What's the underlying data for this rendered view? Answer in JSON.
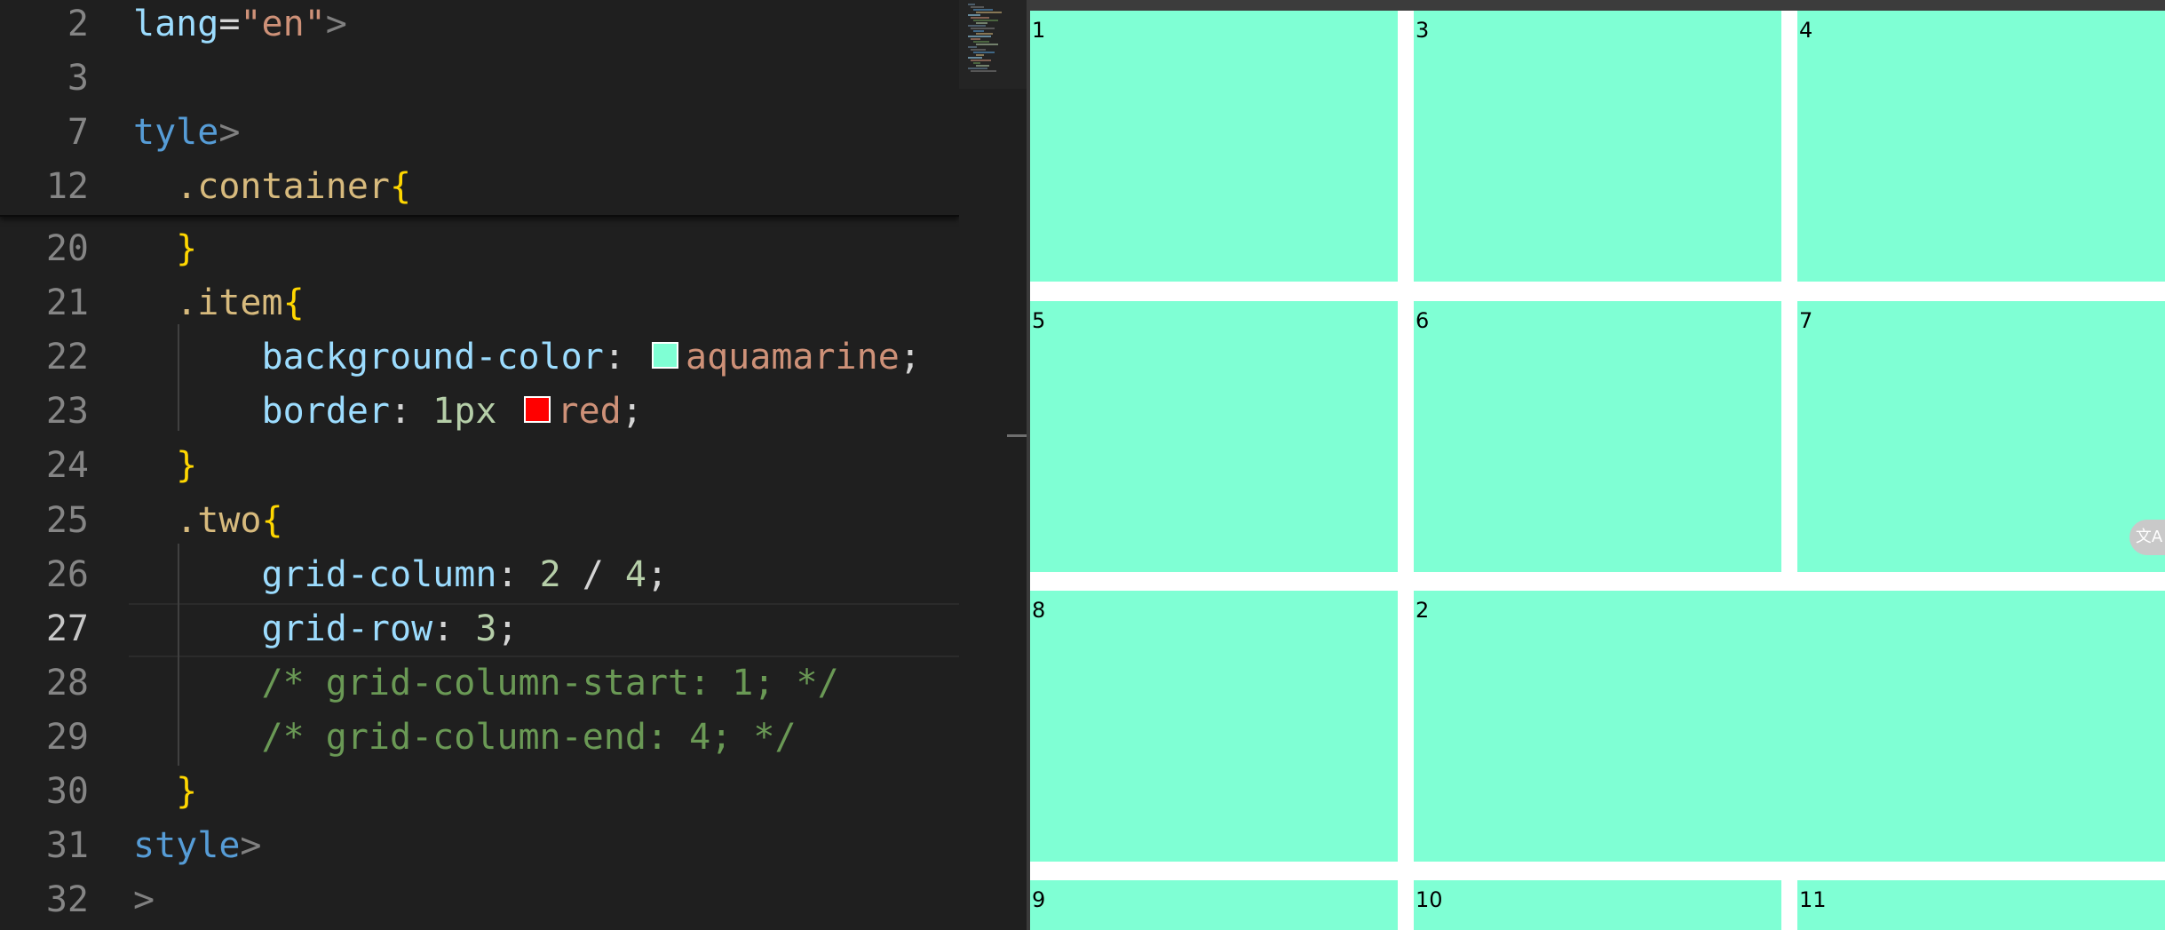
{
  "editor": {
    "sticky_lines": [
      {
        "num": "2",
        "tokens": [
          {
            "t": "lang",
            "c": "t-attr"
          },
          {
            "t": "=",
            "c": "t-def"
          },
          {
            "t": "\"en\"",
            "c": "t-str"
          },
          {
            "t": ">",
            "c": "t-punc"
          }
        ]
      },
      {
        "num": "3",
        "tokens": [
          {
            "t": "",
            "c": "t-def"
          }
        ]
      },
      {
        "num": "7",
        "tokens": [
          {
            "t": "tyle",
            "c": "t-tag"
          },
          {
            "t": ">",
            "c": "t-punc"
          }
        ]
      },
      {
        "num": "12",
        "tokens": [
          {
            "t": "  .container",
            "c": "t-sel"
          },
          {
            "t": "{",
            "c": "t-brace"
          }
        ]
      }
    ],
    "lines": [
      {
        "num": "20",
        "tokens": [
          {
            "t": "  ",
            "c": "t-def"
          },
          {
            "t": "}",
            "c": "t-brace"
          }
        ]
      },
      {
        "num": "21",
        "tokens": [
          {
            "t": "  .item",
            "c": "t-sel"
          },
          {
            "t": "{",
            "c": "t-brace"
          }
        ]
      },
      {
        "num": "22",
        "tokens": [
          {
            "t": "      background-color",
            "c": "t-prop"
          },
          {
            "t": ": ",
            "c": "t-def"
          },
          {
            "swatch": "#7fffd4"
          },
          {
            "t": "aquamarine",
            "c": "t-val"
          },
          {
            "t": ";",
            "c": "t-def"
          }
        ]
      },
      {
        "num": "23",
        "tokens": [
          {
            "t": "      border",
            "c": "t-prop"
          },
          {
            "t": ": ",
            "c": "t-def"
          },
          {
            "t": "1px",
            "c": "t-num"
          },
          {
            "t": " ",
            "c": "t-def"
          },
          {
            "swatch": "#ff0000"
          },
          {
            "t": "red",
            "c": "t-val"
          },
          {
            "t": ";",
            "c": "t-def"
          }
        ]
      },
      {
        "num": "24",
        "tokens": [
          {
            "t": "  ",
            "c": "t-def"
          },
          {
            "t": "}",
            "c": "t-brace"
          }
        ]
      },
      {
        "num": "25",
        "tokens": [
          {
            "t": "  .two",
            "c": "t-sel"
          },
          {
            "t": "{",
            "c": "t-brace"
          }
        ]
      },
      {
        "num": "26",
        "tokens": [
          {
            "t": "      grid-column",
            "c": "t-prop"
          },
          {
            "t": ": ",
            "c": "t-def"
          },
          {
            "t": "2",
            "c": "t-num"
          },
          {
            "t": " / ",
            "c": "t-def"
          },
          {
            "t": "4",
            "c": "t-num"
          },
          {
            "t": ";",
            "c": "t-def"
          }
        ]
      },
      {
        "num": "27",
        "active": true,
        "tokens": [
          {
            "t": "      grid-row",
            "c": "t-prop"
          },
          {
            "t": ": ",
            "c": "t-def"
          },
          {
            "t": "3",
            "c": "t-num"
          },
          {
            "t": ";",
            "c": "t-def"
          }
        ]
      },
      {
        "num": "28",
        "tokens": [
          {
            "t": "      /* grid-column-start: 1; */",
            "c": "t-com"
          }
        ]
      },
      {
        "num": "29",
        "tokens": [
          {
            "t": "      /* grid-column-end: 4; */",
            "c": "t-com"
          }
        ]
      },
      {
        "num": "30",
        "tokens": [
          {
            "t": "  ",
            "c": "t-def"
          },
          {
            "t": "}",
            "c": "t-brace"
          }
        ]
      },
      {
        "num": "31",
        "tokens": [
          {
            "t": "style",
            "c": "t-tag"
          },
          {
            "t": ">",
            "c": "t-punc"
          }
        ]
      },
      {
        "num": "32",
        "tokens": [
          {
            "t": ">",
            "c": "t-punc"
          }
        ]
      }
    ]
  },
  "preview": {
    "cells": [
      {
        "label": "1"
      },
      {
        "label": "3"
      },
      {
        "label": "4"
      },
      {
        "label": "5"
      },
      {
        "label": "6"
      },
      {
        "label": "7"
      },
      {
        "label": "8"
      },
      {
        "label": "2"
      },
      {
        "label": "9"
      },
      {
        "label": "10"
      },
      {
        "label": "11"
      }
    ],
    "cell_color": "#7fffd4",
    "translate_icon": "translate-icon",
    "translate_glyph": "文A"
  }
}
